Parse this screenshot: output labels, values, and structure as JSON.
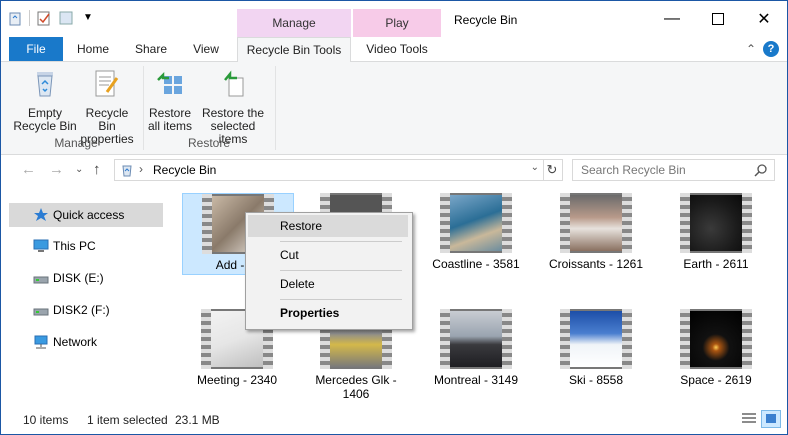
{
  "window": {
    "title": "Recycle Bin"
  },
  "context_groups": {
    "manage": "Manage",
    "play": "Play"
  },
  "tabs": {
    "file": "File",
    "home": "Home",
    "share": "Share",
    "view": "View",
    "recycle_bin_tools": "Recycle Bin Tools",
    "video_tools": "Video Tools"
  },
  "ribbon": {
    "empty_line1": "Empty",
    "empty_line2": "Recycle Bin",
    "props_line1": "Recycle Bin",
    "props_line2": "properties",
    "manage_group": "Manage",
    "restore_all_line1": "Restore",
    "restore_all_line2": "all items",
    "restore_sel_line1": "Restore the",
    "restore_sel_line2": "selected items",
    "restore_group": "Restore"
  },
  "address": {
    "path": "Recycle Bin",
    "search_placeholder": "Search Recycle Bin"
  },
  "nav": {
    "items": [
      {
        "label": "Quick access",
        "icon": "star-icon"
      },
      {
        "label": "This PC",
        "icon": "monitor-icon"
      },
      {
        "label": "DISK (E:)",
        "icon": "drive-icon"
      },
      {
        "label": "DISK2 (F:)",
        "icon": "drive-icon"
      },
      {
        "label": "Network",
        "icon": "network-icon"
      }
    ]
  },
  "files": [
    {
      "label": "Add - 11"
    },
    {
      "label": ""
    },
    {
      "label": "Coastline - 3581"
    },
    {
      "label": "Croissants - 1261"
    },
    {
      "label": "Earth - 2611"
    },
    {
      "label": "Meeting - 2340"
    },
    {
      "label": "Mercedes Glk - 1406"
    },
    {
      "label": "Montreal - 3149"
    },
    {
      "label": "Ski - 8558"
    },
    {
      "label": "Space - 2619"
    }
  ],
  "context_menu": {
    "restore": "Restore",
    "cut": "Cut",
    "delete": "Delete",
    "properties": "Properties"
  },
  "status": {
    "count": "10 items",
    "selection": "1 item selected",
    "size": "23.1 MB"
  },
  "colors": {
    "accent": "#1979ca",
    "selection": "#cce8ff",
    "manage": "#f2d5f2",
    "play": "#f7cbe8"
  }
}
